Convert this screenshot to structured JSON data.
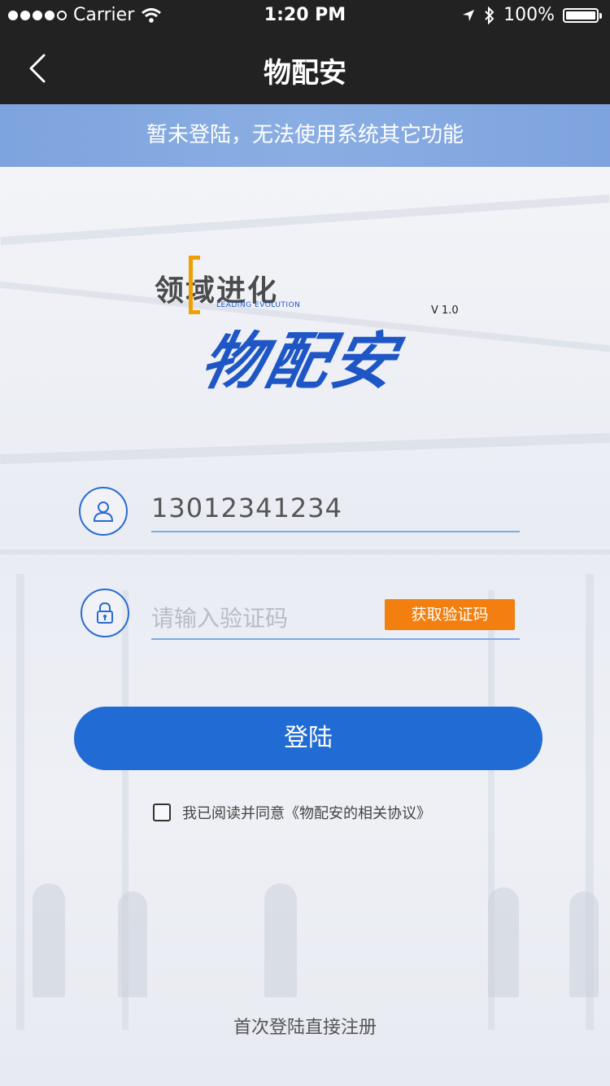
{
  "status_bar": {
    "carrier": "Carrier",
    "time": "1:20 PM",
    "battery": "100%",
    "battery_level": 1.0,
    "signal_bars": 4,
    "signal_max": 5
  },
  "nav": {
    "title": "物配安",
    "back_icon": "chevron-left-icon"
  },
  "notice": {
    "text": "暂未登陆，无法使用系统其它功能"
  },
  "logo": {
    "top_text": "领域进化",
    "sub_text": "LEADING EVOLUTION",
    "version": "V 1.0",
    "main_text": "物配安"
  },
  "form": {
    "phone_icon": "user-icon",
    "phone_value": "13012341234",
    "code_icon": "lock-icon",
    "code_placeholder": "请输入验证码",
    "get_code_label": "获取验证码",
    "login_label": "登陆"
  },
  "agreement": {
    "checked": false,
    "text": "我已阅读并同意《物配安的相关协议》"
  },
  "footer": {
    "register_text": "首次登陆直接注册"
  },
  "colors": {
    "accent": "#216bd4",
    "orange": "#f27f10",
    "notice_bg": "#7ea3de",
    "bar_bg": "#222222"
  }
}
